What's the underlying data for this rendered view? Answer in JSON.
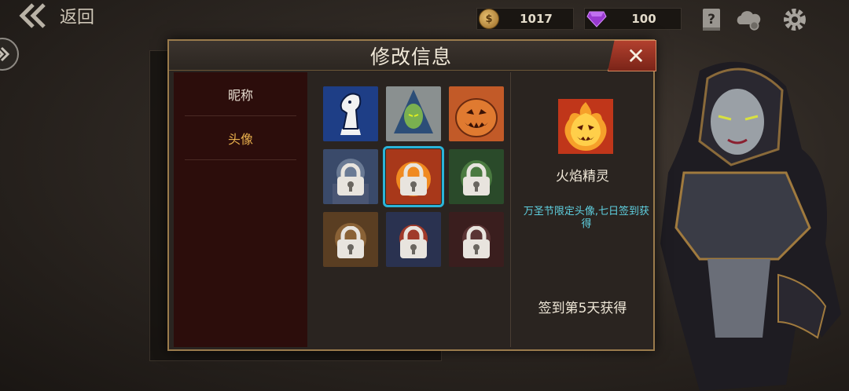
{
  "topbar": {
    "back_label": "返回",
    "gold": "1017",
    "gems": "100"
  },
  "icons": {
    "back": "double-chevron-left-icon",
    "side_toggle": "double-chevron-right-icon",
    "gold": "gold-coin-icon",
    "gem": "purple-gem-icon",
    "help": "help-book-icon",
    "cloud": "cloud-settings-icon",
    "settings": "gear-icon",
    "lock": "padlock-icon"
  },
  "modal": {
    "title": "修改信息",
    "close_label": "✕",
    "menu": [
      {
        "label": "昵称",
        "active": false
      },
      {
        "label": "头像",
        "active": true
      }
    ]
  },
  "avatars": [
    {
      "name": "white-horse-avatar",
      "locked": false,
      "selected": false
    },
    {
      "name": "hooded-elf-avatar",
      "locked": false,
      "selected": false
    },
    {
      "name": "pumpkin-avatar",
      "locked": false,
      "selected": false
    },
    {
      "name": "knight-avatar",
      "locked": true,
      "selected": false
    },
    {
      "name": "fire-spirit-avatar",
      "locked": true,
      "selected": true
    },
    {
      "name": "forest-beast-avatar",
      "locked": true,
      "selected": false
    },
    {
      "name": "bear-warrior-avatar",
      "locked": true,
      "selected": false
    },
    {
      "name": "red-hero-avatar",
      "locked": true,
      "selected": false
    },
    {
      "name": "dark-knight-avatar",
      "locked": true,
      "selected": false
    }
  ],
  "detail": {
    "name": "火焰精灵",
    "description": "万圣节限定头像,七日签到获得",
    "condition": "签到第5天获得"
  },
  "colors": {
    "accent_active": "#e9b04d",
    "description": "#5fd0e0",
    "selection": "#2ab4d8",
    "close_button": "#a8392a"
  }
}
